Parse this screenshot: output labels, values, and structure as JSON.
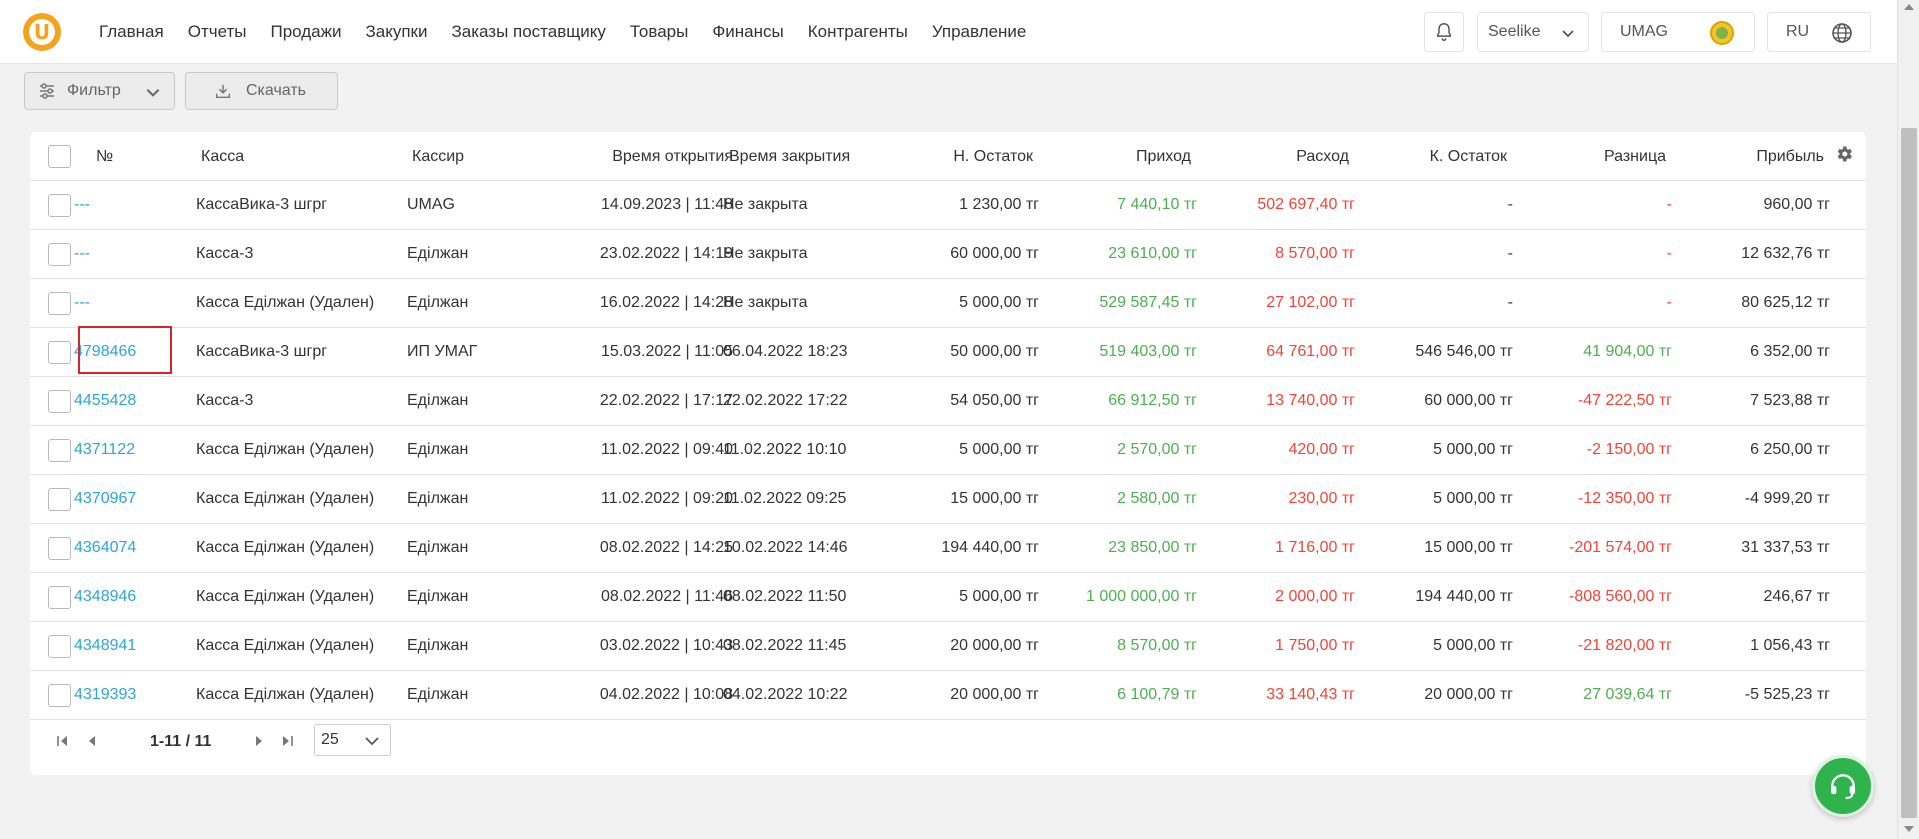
{
  "nav": {
    "items": [
      "Главная",
      "Отчеты",
      "Продажи",
      "Закупки",
      "Заказы поставщику",
      "Товары",
      "Финансы",
      "Контрагенты",
      "Управление"
    ]
  },
  "header": {
    "store": "Seelike",
    "org": "UMAG",
    "lang": "RU"
  },
  "toolbar": {
    "filter_label": "Фильтр",
    "download_label": "Скачать"
  },
  "table": {
    "headers": {
      "num": "№",
      "kassa": "Касса",
      "cashier": "Кассир",
      "open": "Время открытия",
      "close": "Время закрытия",
      "start": "Н. Остаток",
      "income": "Приход",
      "expense": "Расход",
      "end": "К. Остаток",
      "diff": "Разница",
      "profit": "Прибыль"
    },
    "rows": [
      {
        "num": "---",
        "kassa": "КассаВика-3 шгрг",
        "cashier": "UMAG",
        "open": "14.09.2023 | 11:48",
        "close": "Не закрыта",
        "start": "1 230,00 тг",
        "income": "7 440,10 тг",
        "expense": "502 697,40 тг",
        "end": "-",
        "diff": "-",
        "diff_color": "red",
        "profit": "960,00 тг"
      },
      {
        "num": "---",
        "kassa": "Касса-3",
        "cashier": "Еділжан",
        "open": "23.02.2022 | 14:19",
        "close": "Не закрыта",
        "start": "60 000,00 тг",
        "income": "23 610,00 тг",
        "expense": "8 570,00 тг",
        "end": "-",
        "diff": "-",
        "diff_color": "red",
        "profit": "12 632,76 тг"
      },
      {
        "num": "---",
        "kassa": "Касса Еділжан (Удален)",
        "cashier": "Еділжан",
        "open": "16.02.2022 | 14:28",
        "close": "Не закрыта",
        "start": "5 000,00 тг",
        "income": "529 587,45 тг",
        "expense": "27 102,00 тг",
        "end": "-",
        "diff": "-",
        "diff_color": "red",
        "profit": "80 625,12 тг"
      },
      {
        "num": "4798466",
        "kassa": "КассаВика-3 шгрг",
        "cashier": "ИП УМАГ",
        "open": "15.03.2022 | 11:05",
        "close": "06.04.2022 18:23",
        "start": "50 000,00 тг",
        "income": "519 403,00 тг",
        "expense": "64 761,00 тг",
        "end": "546 546,00 тг",
        "diff": "41 904,00 тг",
        "diff_color": "green",
        "profit": "6 352,00 тг"
      },
      {
        "num": "4455428",
        "kassa": "Касса-3",
        "cashier": "Еділжан",
        "open": "22.02.2022 | 17:17",
        "close": "22.02.2022 17:22",
        "start": "54 050,00 тг",
        "income": "66 912,50 тг",
        "expense": "13 740,00 тг",
        "end": "60 000,00 тг",
        "diff": "-47 222,50 тг",
        "diff_color": "red",
        "profit": "7 523,88 тг"
      },
      {
        "num": "4371122",
        "kassa": "Касса Еділжан (Удален)",
        "cashier": "Еділжан",
        "open": "11.02.2022 | 09:40",
        "close": "11.02.2022 10:10",
        "start": "5 000,00 тг",
        "income": "2 570,00 тг",
        "expense": "420,00 тг",
        "end": "5 000,00 тг",
        "diff": "-2 150,00 тг",
        "diff_color": "red",
        "profit": "6 250,00 тг"
      },
      {
        "num": "4370967",
        "kassa": "Касса Еділжан (Удален)",
        "cashier": "Еділжан",
        "open": "11.02.2022 | 09:20",
        "close": "11.02.2022 09:25",
        "start": "15 000,00 тг",
        "income": "2 580,00 тг",
        "expense": "230,00 тг",
        "end": "5 000,00 тг",
        "diff": "-12 350,00 тг",
        "diff_color": "red",
        "profit": "-4 999,20 тг"
      },
      {
        "num": "4364074",
        "kassa": "Касса Еділжан (Удален)",
        "cashier": "Еділжан",
        "open": "08.02.2022 | 14:25",
        "close": "10.02.2022 14:46",
        "start": "194 440,00 тг",
        "income": "23 850,00 тг",
        "expense": "1 716,00 тг",
        "end": "15 000,00 тг",
        "diff": "-201 574,00 тг",
        "diff_color": "red",
        "profit": "31 337,53 тг"
      },
      {
        "num": "4348946",
        "kassa": "Касса Еділжан (Удален)",
        "cashier": "Еділжан",
        "open": "08.02.2022 | 11:46",
        "close": "08.02.2022 11:50",
        "start": "5 000,00 тг",
        "income": "1 000 000,00 тг",
        "expense": "2 000,00 тг",
        "end": "194 440,00 тг",
        "diff": "-808 560,00 тг",
        "diff_color": "red",
        "profit": "246,67 тг"
      },
      {
        "num": "4348941",
        "kassa": "Касса Еділжан (Удален)",
        "cashier": "Еділжан",
        "open": "03.02.2022 | 10:43",
        "close": "08.02.2022 11:45",
        "start": "20 000,00 тг",
        "income": "8 570,00 тг",
        "expense": "1 750,00 тг",
        "end": "5 000,00 тг",
        "diff": "-21 820,00 тг",
        "diff_color": "red",
        "profit": "1 056,43 тг"
      },
      {
        "num": "4319393",
        "kassa": "Касса Еділжан (Удален)",
        "cashier": "Еділжан",
        "open": "04.02.2022 | 10:08",
        "close": "04.02.2022 10:22",
        "start": "20 000,00 тг",
        "income": "6 100,79 тг",
        "expense": "33 140,43 тг",
        "end": "20 000,00 тг",
        "diff": "27 039,64 тг",
        "diff_color": "green",
        "profit": "-5 525,23 тг"
      }
    ]
  },
  "pager": {
    "range": "1-11 / 11",
    "per_page": "25"
  },
  "colors": {
    "accent": "#f5a31a",
    "link": "#2aa6d8",
    "positive": "#4caf50",
    "negative": "#f44336",
    "highlight": "#d9232e",
    "support": "#2fb34c"
  },
  "icons": {
    "bell": "bell-icon",
    "chevron": "chevron-down-icon",
    "globe": "globe-icon",
    "filter": "sliders-icon",
    "download": "download-icon",
    "settings": "gear-icon",
    "support": "headset-icon"
  }
}
